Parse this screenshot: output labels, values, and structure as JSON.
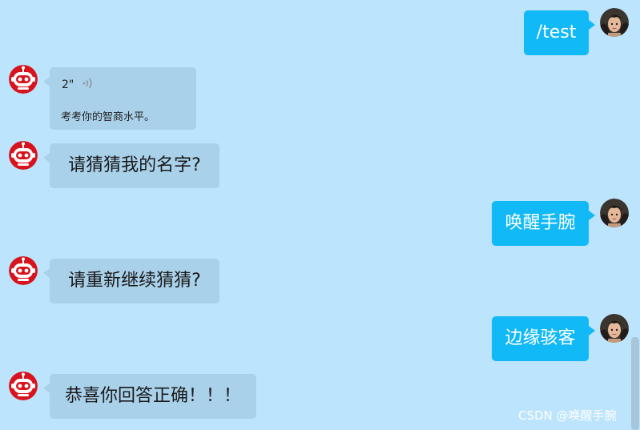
{
  "messages": [
    {
      "sender": "user",
      "text": "/test"
    },
    {
      "sender": "bot",
      "type": "voice",
      "duration": "2\"",
      "caption": "考考你的智商水平。"
    },
    {
      "sender": "bot",
      "text": "请猜猜我的名字?"
    },
    {
      "sender": "user",
      "text": "唤醒手腕"
    },
    {
      "sender": "bot",
      "text": "请重新继续猜猜?"
    },
    {
      "sender": "user",
      "text": "边缘骇客"
    },
    {
      "sender": "bot",
      "text": "恭喜你回答正确！！！"
    }
  ],
  "watermark": "CSDN @唤醒手腕",
  "colors": {
    "background": "#bce4fc",
    "user_bubble": "#11b9f6",
    "bot_bubble": "#a9d1ea",
    "bot_avatar": "#d7141e"
  },
  "icons": {
    "bot_avatar": "robot-avatar-icon",
    "user_avatar": "user-avatar-icon",
    "voice": "voice-wave-icon"
  }
}
